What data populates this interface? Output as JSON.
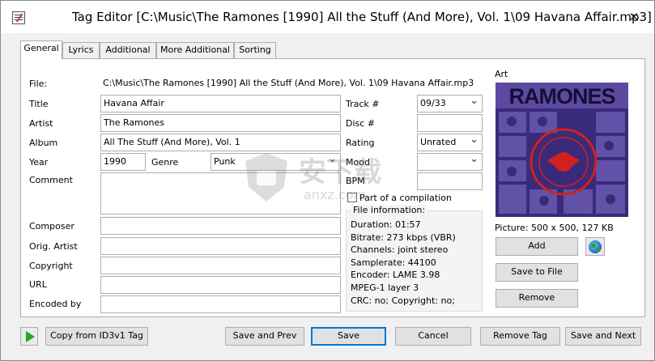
{
  "window": {
    "title": "Tag Editor [C:\\Music\\The Ramones [1990] All the Stuff (And More), Vol. 1\\09 Havana Affair.mp3]",
    "close_label": "✕"
  },
  "tabs": [
    {
      "label": "General"
    },
    {
      "label": "Lyrics"
    },
    {
      "label": "Additional"
    },
    {
      "label": "More Additional"
    },
    {
      "label": "Sorting"
    }
  ],
  "general": {
    "file_label": "File:",
    "file_value": "C:\\Music\\The Ramones [1990] All the Stuff (And More), Vol. 1\\09 Havana Affair.mp3",
    "title_label": "Title",
    "title_value": "Havana Affair",
    "artist_label": "Artist",
    "artist_value": "The Ramones",
    "album_label": "Album",
    "album_value": "All The Stuff (And More), Vol. 1",
    "year_label": "Year",
    "year_value": "1990",
    "genre_label": "Genre",
    "genre_value": "Punk",
    "comment_label": "Comment",
    "comment_value": "",
    "composer_label": "Composer",
    "composer_value": "",
    "orig_artist_label": "Orig. Artist",
    "orig_artist_value": "",
    "copyright_label": "Copyright",
    "copyright_value": "",
    "url_label": "URL",
    "url_value": "",
    "encoded_by_label": "Encoded by",
    "encoded_by_value": "",
    "track_label": "Track #",
    "track_value": "09/33",
    "disc_label": "Disc #",
    "disc_value": "",
    "rating_label": "Rating",
    "rating_value": "Unrated",
    "mood_label": "Mood",
    "mood_value": "",
    "bpm_label": "BPM",
    "bpm_value": "",
    "compilation_label": "Part of a compilation"
  },
  "file_info": {
    "title": "File information:",
    "lines": [
      "Duration: 01:57",
      "Bitrate: 273 kbps (VBR)",
      "Channels: joint stereo",
      "Samplerate: 44100",
      "Encoder: LAME 3.98",
      "MPEG-1 layer 3",
      "CRC: no; Copyright: no;"
    ]
  },
  "art": {
    "label": "Art",
    "picture_info": "Picture: 500 x 500, 127 KB",
    "cover_band_text": "RAMONES",
    "add_label": "Add",
    "save_label": "Save to File",
    "remove_label": "Remove"
  },
  "bottom": {
    "copy_label": "Copy from ID3v1 Tag",
    "save_prev_label": "Save and Prev",
    "save_label": "Save",
    "cancel_label": "Cancel",
    "remove_tag_label": "Remove Tag",
    "save_next_label": "Save and Next"
  },
  "watermark": {
    "text": "安下载",
    "sub": "anxz.com"
  },
  "colors": {
    "accent": "#0078d7",
    "cover_bg": "#3a2a7a",
    "cover_ring": "#d02020",
    "play_green": "#22aa22"
  }
}
